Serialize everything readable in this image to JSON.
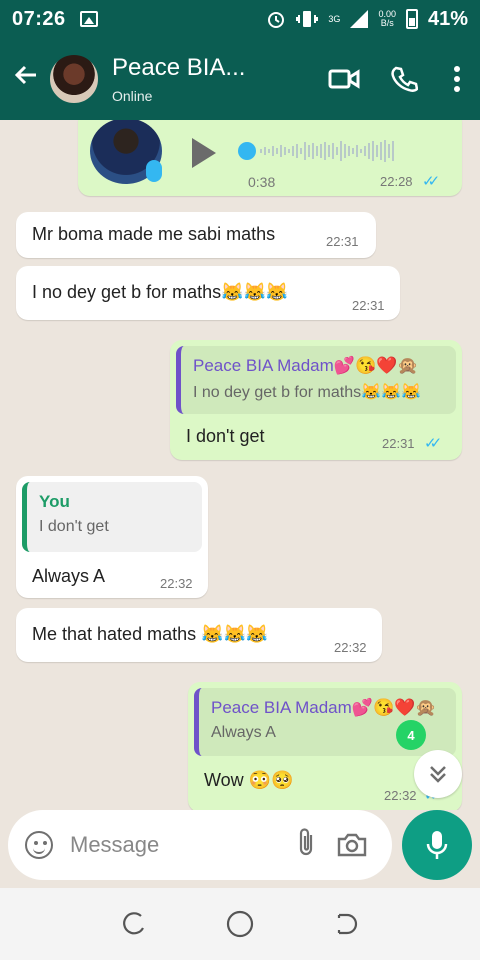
{
  "status_bar": {
    "time": "07:26",
    "network_type": "3G",
    "speed_value": "0.00",
    "speed_unit": "B/s",
    "battery": "41%"
  },
  "header": {
    "contact_name": "Peace BIA...",
    "status": "Online"
  },
  "messages": {
    "voice": {
      "duration": "0:38",
      "time": "22:28"
    },
    "m1": {
      "text": "Mr boma made me sabi maths",
      "time": "22:31"
    },
    "m2": {
      "text": "I no dey get b for maths😹😹😹",
      "time": "22:31"
    },
    "m3": {
      "quote_author": "Peace BIA Madam💕😘❤️🙊",
      "quote_text": "I no dey get b for maths😹😹😹",
      "text": "I don't get",
      "time": "22:31"
    },
    "m4": {
      "quote_author": "You",
      "quote_text": "I don't get",
      "text": "Always A",
      "time": "22:32"
    },
    "m5": {
      "text": "Me that hated maths 😹😹😹",
      "time": "22:32"
    },
    "m6": {
      "quote_author": "Peace BIA Madam💕😘❤️🙊",
      "quote_text": "Always A",
      "text": "Wow 😳🥺",
      "time": "22:32"
    }
  },
  "unread_count": "4",
  "composer": {
    "placeholder": "Message"
  },
  "colors": {
    "header": "#0b5d52",
    "outgoing_bubble": "#dcf8c6",
    "incoming_bubble": "#ffffff",
    "read_ticks": "#34b7f1",
    "mic_fab": "#0e9e84"
  }
}
